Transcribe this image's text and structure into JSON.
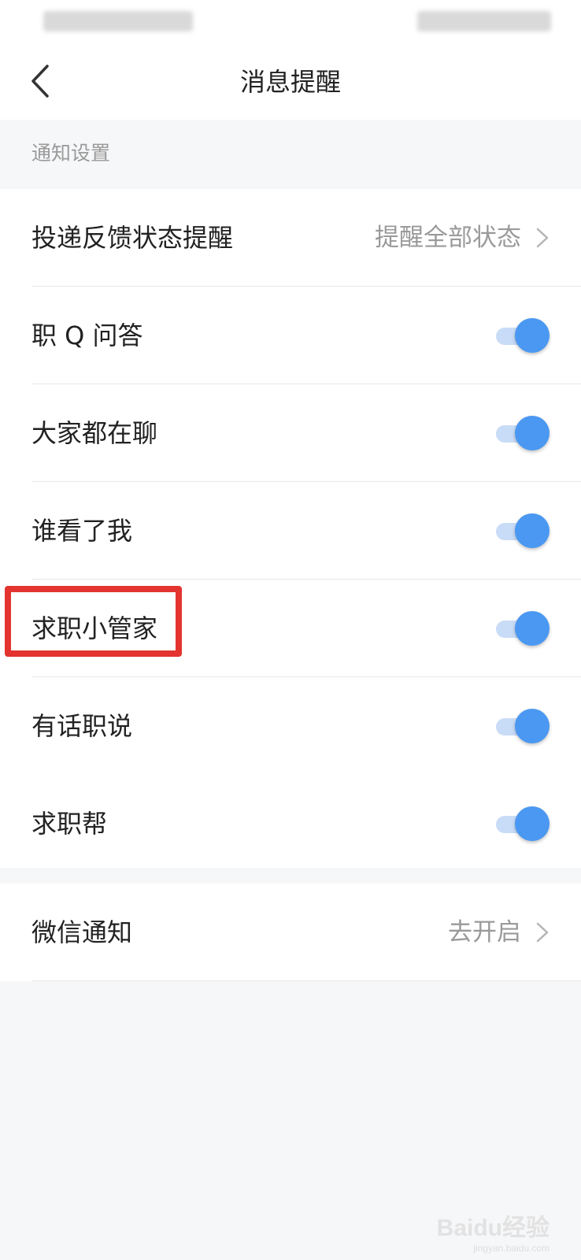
{
  "header": {
    "title": "消息提醒",
    "back_icon": "back-arrow-icon"
  },
  "section_title": "通知设置",
  "settings": {
    "delivery_feedback": {
      "label": "投递反馈状态提醒",
      "value": "提醒全部状态"
    },
    "items": [
      {
        "label": "职 Q 问答",
        "enabled": true
      },
      {
        "label": "大家都在聊",
        "enabled": true
      },
      {
        "label": "谁看了我",
        "enabled": true
      },
      {
        "label": "求职小管家",
        "enabled": true
      },
      {
        "label": "有话职说",
        "enabled": true
      },
      {
        "label": "求职帮",
        "enabled": true
      }
    ]
  },
  "wechat": {
    "label": "微信通知",
    "value": "去开启"
  },
  "watermark": {
    "text": "Baidu经验",
    "sub": "jingyan.baidu.com"
  },
  "colors": {
    "accent": "#4a98f2",
    "highlight": "#e3342f",
    "secondary_text": "#9a9a9a"
  }
}
